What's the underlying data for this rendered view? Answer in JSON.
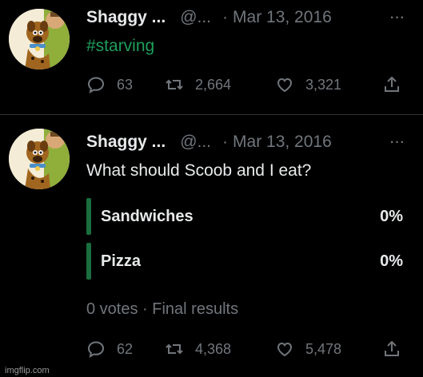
{
  "tweets": [
    {
      "author": {
        "name": "Shaggy ...",
        "handle": "@...",
        "separator": "·",
        "date": "Mar 13, 2016"
      },
      "more_label": "···",
      "text": "#starving",
      "stats": {
        "replies": "63",
        "retweets": "2,664",
        "likes": "3,321"
      }
    },
    {
      "author": {
        "name": "Shaggy ...",
        "handle": "@...",
        "separator": "·",
        "date": "Mar 13, 2016"
      },
      "more_label": "···",
      "text": "What should Scoob and I eat?",
      "poll": {
        "options": [
          {
            "label": "Sandwiches",
            "percent": "0%"
          },
          {
            "label": "Pizza",
            "percent": "0%"
          }
        ],
        "meta": "0 votes · Final results"
      },
      "stats": {
        "replies": "62",
        "retweets": "4,368",
        "likes": "5,478"
      }
    }
  ],
  "watermark": "imgflip.com",
  "colors": {
    "background": "#000000",
    "text": "#e7e9ea",
    "muted": "#71767b",
    "hashtag": "#1e9e5b",
    "poll_bar": "#1a6e3f"
  }
}
